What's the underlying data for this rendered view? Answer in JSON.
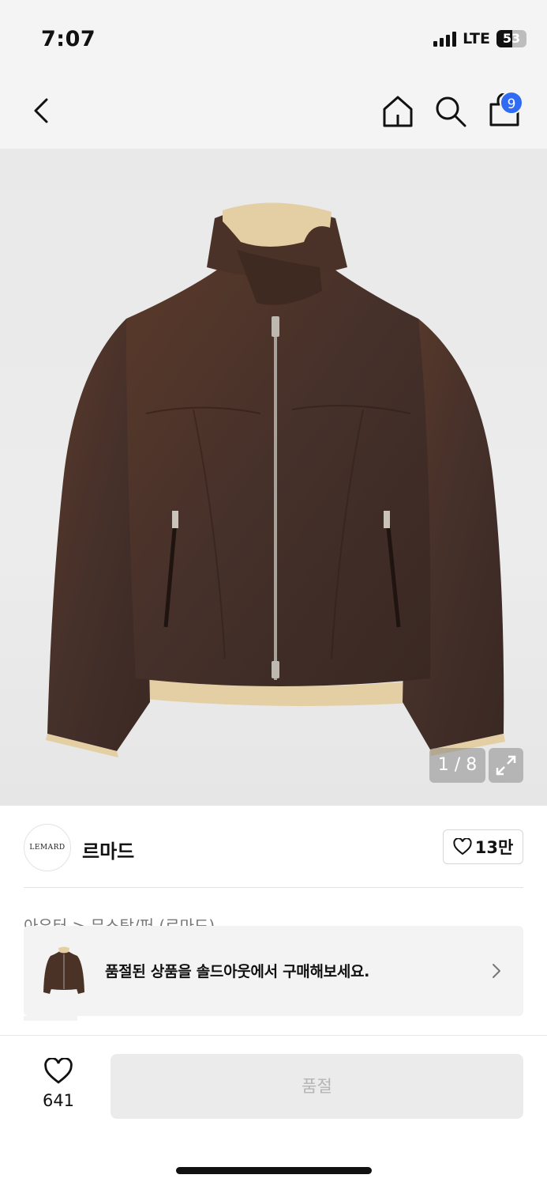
{
  "status_bar": {
    "time": "7:07",
    "network": "LTE",
    "battery_level": 53,
    "battery_text": "53"
  },
  "nav": {
    "cart_count": "9",
    "icons": [
      "chevron-left-icon",
      "home-icon",
      "search-icon",
      "shopping-bag-icon"
    ]
  },
  "product": {
    "image_counter": "1 / 8",
    "image_subject": "brown shearling jacket"
  },
  "brand": {
    "logo_text": "LEMARD",
    "name": "르마드",
    "likes": "13만"
  },
  "breadcrumb": "아우터 > 무스탕/퍼 (르마드)",
  "banner": {
    "text": "품절된 상품을 솔드아웃에서 구매해보세요."
  },
  "bottom_bar": {
    "wish_count": "641",
    "action_label": "품절"
  },
  "colors": {
    "accent_badge": "#2f6cf3",
    "jacket_brown": "#4a3226",
    "shearling": "#e4cfa4"
  }
}
